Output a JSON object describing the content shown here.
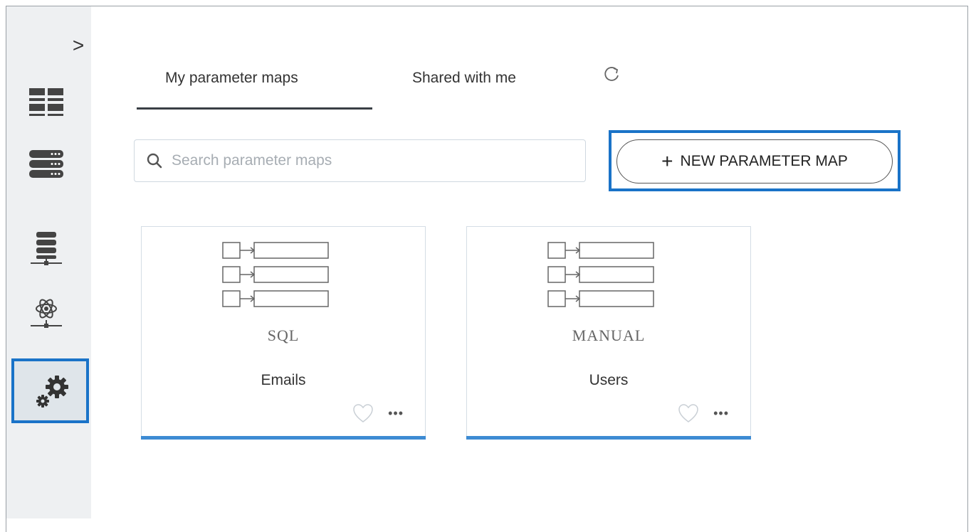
{
  "sidebar": {
    "collapse_label": ">",
    "items": [
      {
        "name": "dashboard-grid",
        "icon": "grid-icon"
      },
      {
        "name": "storage",
        "icon": "database-stack-icon"
      },
      {
        "name": "data-network",
        "icon": "server-network-icon"
      },
      {
        "name": "ai-network",
        "icon": "atom-network-icon"
      },
      {
        "name": "settings",
        "icon": "gears-icon",
        "selected": true
      }
    ]
  },
  "tabs": [
    {
      "label": "My parameter maps",
      "active": true
    },
    {
      "label": "Shared with me",
      "active": false
    }
  ],
  "search": {
    "placeholder": "Search parameter maps",
    "value": ""
  },
  "new_button": {
    "label": "NEW PARAMETER MAP"
  },
  "cards": [
    {
      "type": "SQL",
      "name": "Emails",
      "favorite": false
    },
    {
      "type": "MANUAL",
      "name": "Users",
      "favorite": false
    }
  ],
  "colors": {
    "accent": "#1a73c8",
    "card_bar": "#3d8bd3",
    "sidebar_bg": "#eef0f2"
  }
}
